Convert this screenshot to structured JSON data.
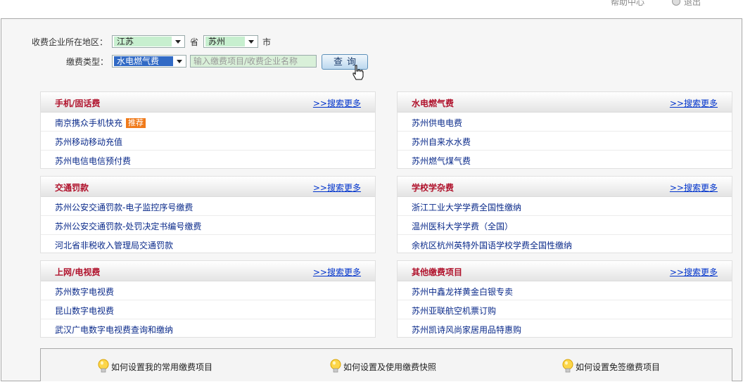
{
  "topbar": {
    "item1": "帮助中心",
    "item2": "退出"
  },
  "search": {
    "region_label": "收费企业所在地区：",
    "province_value": "江苏",
    "province_suffix": "省",
    "city_value": "苏州",
    "city_suffix": "市",
    "type_label": "缴费类型：",
    "type_value": "水电燃气费",
    "keyword_placeholder": "输入缴费项目/收费企业名称",
    "query_button": "查询"
  },
  "panels": [
    {
      "title": "手机/固话费",
      "more": ">>搜索更多",
      "items": [
        {
          "text": "南京携众手机快充",
          "badge": "推荐"
        },
        {
          "text": "苏州移动移动充值"
        },
        {
          "text": "苏州电信电信预付费"
        }
      ]
    },
    {
      "title": "水电燃气费",
      "more": ">>搜索更多",
      "items": [
        {
          "text": "苏州供电电费"
        },
        {
          "text": "苏州自来水水费"
        },
        {
          "text": "苏州燃气煤气费"
        }
      ]
    },
    {
      "title": "交通罚款",
      "more": ">>搜索更多",
      "items": [
        {
          "text": "苏州公安交通罚款-电子监控序号缴费"
        },
        {
          "text": "苏州公安交通罚款-处罚决定书编号缴费"
        },
        {
          "text": "河北省非税收入管理局交通罚款"
        }
      ]
    },
    {
      "title": "学校学杂费",
      "more": ">>搜索更多",
      "items": [
        {
          "text": "浙江工业大学学费全国性缴纳"
        },
        {
          "text": "温州医科大学学费（全国）"
        },
        {
          "text": "余杭区杭州英特外国语学校学费全国性缴纳"
        }
      ]
    },
    {
      "title": "上网/电视费",
      "more": ">>搜索更多",
      "items": [
        {
          "text": "苏州数字电视费"
        },
        {
          "text": "昆山数字电视费"
        },
        {
          "text": "武汉广电数字电视费查询和缴纳"
        }
      ]
    },
    {
      "title": "其他缴费项目",
      "more": ">>搜索更多",
      "items": [
        {
          "text": "苏州中鑫龙祥黄金白银专卖"
        },
        {
          "text": "苏州亚联航空机票订购"
        },
        {
          "text": "苏州凯诗风尚家居用品特惠购"
        }
      ]
    }
  ],
  "help": [
    "如何设置我的常用缴费项目",
    "如何设置及使用缴费快照",
    "如何设置免签缴费项目"
  ]
}
